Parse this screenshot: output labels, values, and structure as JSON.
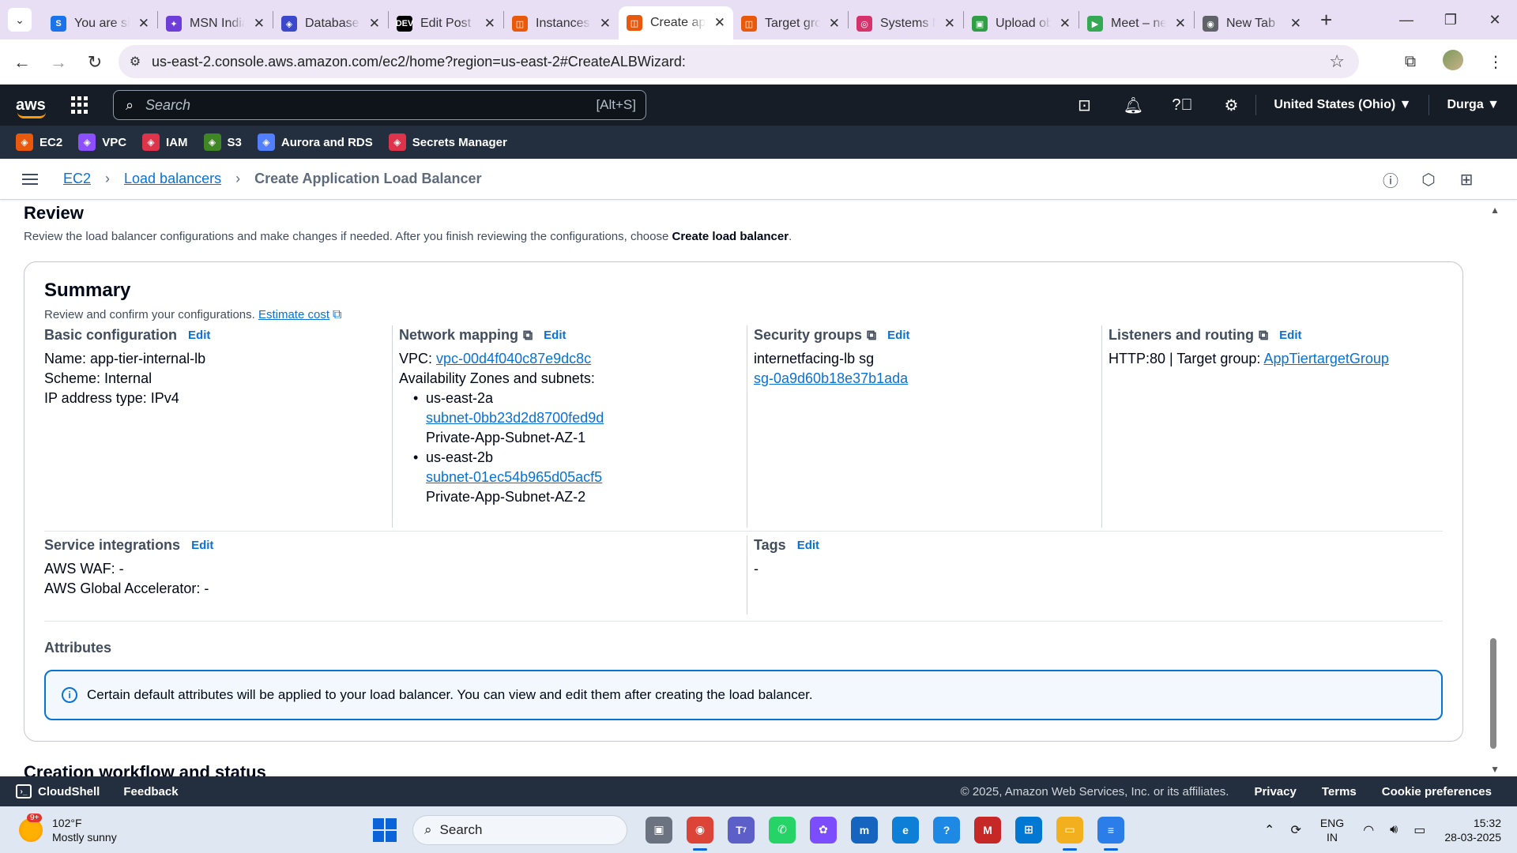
{
  "browser": {
    "tabs": [
      {
        "title": "You are signed in",
        "color": "#1a73e8",
        "glyph": "S",
        "active": false
      },
      {
        "title": "MSN India",
        "color": "#6e3fd8",
        "glyph": "✦",
        "active": false
      },
      {
        "title": "Database",
        "color": "#3b48cc",
        "glyph": "◈",
        "active": false
      },
      {
        "title": "Edit Post",
        "color": "#000000",
        "glyph": "DEV",
        "active": false
      },
      {
        "title": "Instances",
        "color": "#e8590c",
        "glyph": "◫",
        "active": false
      },
      {
        "title": "Create application load balancer",
        "color": "#e8590c",
        "glyph": "◫",
        "active": true
      },
      {
        "title": "Target groups",
        "color": "#e8590c",
        "glyph": "◫",
        "active": false
      },
      {
        "title": "Systems Manager",
        "color": "#d6336c",
        "glyph": "◎",
        "active": false
      },
      {
        "title": "Upload objects",
        "color": "#2f9e44",
        "glyph": "▣",
        "active": false
      },
      {
        "title": "Meet – new meeting",
        "color": "#34a853",
        "glyph": "▶",
        "active": false
      },
      {
        "title": "New Tab",
        "color": "#5f6368",
        "glyph": "◉",
        "active": false
      }
    ],
    "url": "us-east-2.console.aws.amazon.com/ec2/home?region=us-east-2#CreateALBWizard:"
  },
  "aws_header": {
    "logo": "aws",
    "search_placeholder": "Search",
    "search_shortcut": "[Alt+S]",
    "region": "United States (Ohio) ▼",
    "user": "Durga ▼"
  },
  "favorites": [
    {
      "label": "EC2",
      "color": "#e8590c"
    },
    {
      "label": "VPC",
      "color": "#8c4fff"
    },
    {
      "label": "IAM",
      "color": "#dd344c"
    },
    {
      "label": "S3",
      "color": "#3f8624"
    },
    {
      "label": "Aurora and RDS",
      "color": "#527fff"
    },
    {
      "label": "Secrets Manager",
      "color": "#dd344c"
    }
  ],
  "breadcrumb": {
    "items": [
      "EC2",
      "Load balancers"
    ],
    "current": "Create Application Load Balancer"
  },
  "review": {
    "title": "Review",
    "desc_prefix": "Review the load balancer configurations and make changes if needed. After you finish reviewing the configurations, choose ",
    "desc_bold": "Create load balancer",
    "desc_suffix": "."
  },
  "summary": {
    "title": "Summary",
    "subtitle": "Review and confirm your configurations.",
    "estimate_link": "Estimate cost",
    "edit_label": "Edit",
    "basic": {
      "head": "Basic configuration",
      "name": "Name: app-tier-internal-lb",
      "scheme": "Scheme: Internal",
      "ip": "IP address type: IPv4"
    },
    "network": {
      "head": "Network mapping",
      "vpc_prefix": "VPC: ",
      "vpc_link": "vpc-00d4f040c87e9dc8c",
      "az_label": "Availability Zones and subnets:",
      "zones": [
        {
          "az": "us-east-2a",
          "subnet": "subnet-0bb23d2d8700fed9d",
          "name": "Private-App-Subnet-AZ-1"
        },
        {
          "az": "us-east-2b",
          "subnet": "subnet-01ec54b965d05acf5",
          "name": "Private-App-Subnet-AZ-2"
        }
      ]
    },
    "security": {
      "head": "Security groups",
      "name": "internetfacing-lb sg",
      "id": "sg-0a9d60b18e37b1ada"
    },
    "listeners": {
      "head": "Listeners and routing",
      "prefix": "HTTP:80 | Target group: ",
      "link": "AppTiertargetGroup"
    },
    "services": {
      "head": "Service integrations",
      "waf": "AWS WAF: -",
      "ga": "AWS Global Accelerator: -"
    },
    "tags": {
      "head": "Tags",
      "value": "-"
    },
    "attributes": {
      "head": "Attributes",
      "info": "Certain default attributes will be applied to your load balancer. You can view and edit them after creating the load balancer."
    }
  },
  "next_section": "Creation workflow and status",
  "footer": {
    "cloudshell": "CloudShell",
    "feedback": "Feedback",
    "copyright": "© 2025, Amazon Web Services, Inc. or its affiliates.",
    "links": [
      "Privacy",
      "Terms",
      "Cookie preferences"
    ]
  },
  "taskbar": {
    "weather_badge": "9+",
    "temp": "102°F",
    "condition": "Mostly sunny",
    "search": "Search",
    "teams_badge": "7",
    "lang_top": "ENG",
    "lang_bottom": "IN",
    "time": "15:32",
    "date": "28-03-2025"
  }
}
